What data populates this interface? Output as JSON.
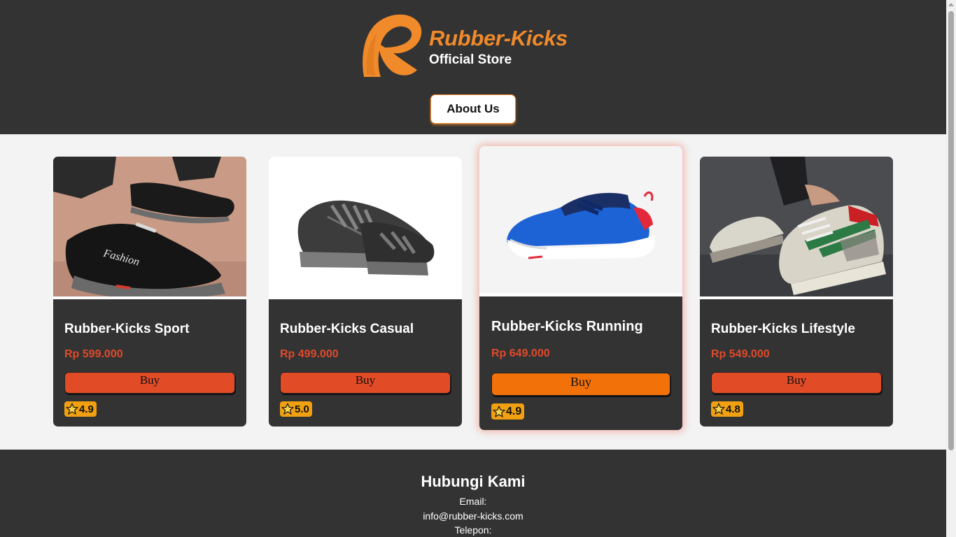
{
  "header": {
    "brand_name": "Rubber-Kicks",
    "brand_sub": "Official Store",
    "about_label": "About Us"
  },
  "products": [
    {
      "name": "Rubber-Kicks Sport",
      "price": "Rp 599.000",
      "buy_label": "Buy",
      "rating": "4.9",
      "image": "black-slip-on-sneaker"
    },
    {
      "name": "Rubber-Kicks Casual",
      "price": "Rp 499.000",
      "buy_label": "Buy",
      "rating": "5.0",
      "image": "black-lace-up-sneaker"
    },
    {
      "name": "Rubber-Kicks Running",
      "price": "Rp 649.000",
      "buy_label": "Buy",
      "rating": "4.9",
      "image": "blue-running-shoe"
    },
    {
      "name": "Rubber-Kicks Lifestyle",
      "price": "Rp 549.000",
      "buy_label": "Buy",
      "rating": "4.8",
      "image": "grey-green-lifestyle-sneaker"
    }
  ],
  "footer": {
    "title": "Hubungi Kami",
    "email_label": "Email:",
    "email": "info@rubber-kicks.com",
    "phone_label": "Telepon:"
  },
  "colors": {
    "dark": "#333333",
    "brand_orange": "#f08a2b",
    "price_red": "#e04a2b",
    "buy_button": "#e14b26",
    "buy_button_featured": "#f27209",
    "rating_badge": "#f0a010"
  }
}
